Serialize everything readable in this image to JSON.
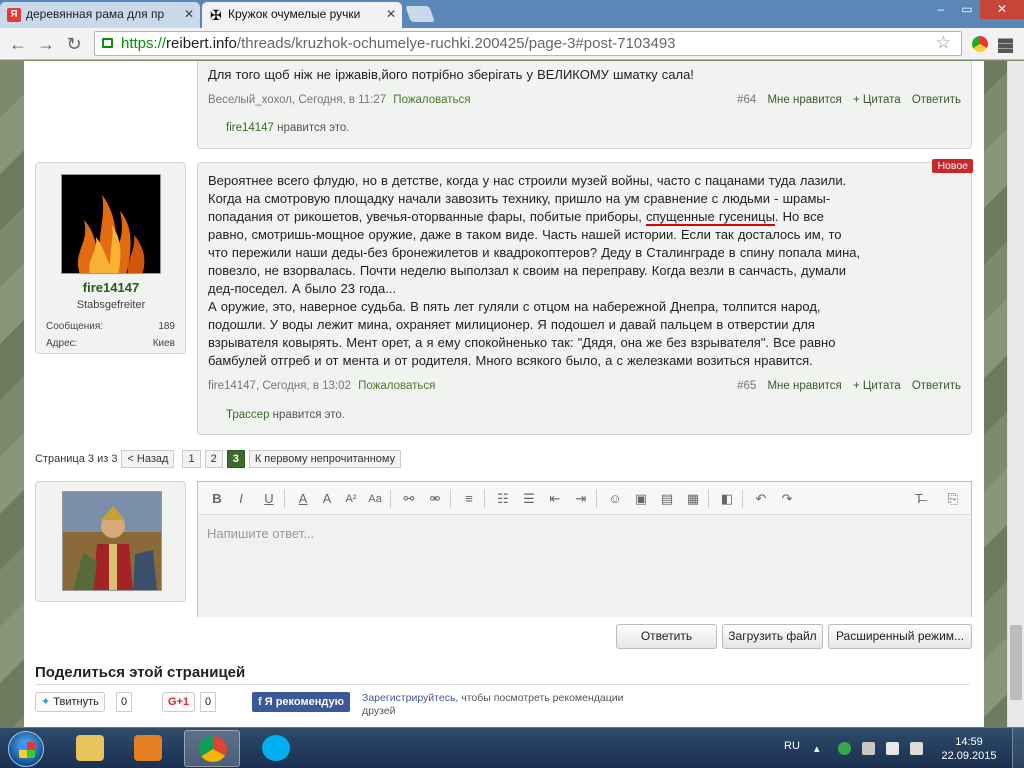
{
  "browser": {
    "tabs": [
      {
        "title": "деревянная рама для пр",
        "favicon": "Я"
      },
      {
        "title": "Кружок очумелые ручки",
        "favicon": "✠"
      }
    ],
    "url_secure": "https://",
    "url_domain": "reibert.info",
    "url_path": "/threads/kruzhok-ochumelye-ruchki.200425/page-3#post-7103493",
    "window_buttons": [
      "–",
      "▭",
      "✕"
    ]
  },
  "posts": [
    {
      "text": "Для того щоб ніж не іржавів,його потрібно зберігать у ВЕЛИКОМУ шматку сала!",
      "author": "Веселый_хохол",
      "time": "Сегодня, в 11:27",
      "report": "Пожаловаться",
      "number": "#64",
      "like": "Мне нравится",
      "quote": "+ Цитата",
      "reply": "Ответить",
      "liked_by": "fire14147",
      "liked_suffix": "нравится это."
    },
    {
      "badge": "Новое",
      "lines": [
        "Вероятнее всего флудю, но в детстве, когда у нас строили музей войны, часто с пацанами туда лазили.",
        "Когда на смотровую площадку начали завозить технику, пришло на ум сравнение с людьми - шрамы-",
        "попадания от рикошетов, увечья-оторванные фары, побитые приборы,",
        "спущенные гусеницы",
        ". Но все",
        "равно, смотришь-мощное оружие, даже в таком виде. Часть нашей истории. Если так досталось им, то",
        "что пережили наши деды-без бронежилетов и квадрокоптеров? Деду в Сталинграде в спину попала мина,",
        "повезло, не взорвалась. Почти неделю выползал к своим на переправу. Когда везли в санчасть, думали",
        "дед-поседел. А было 23 года...",
        "А оружие, это, наверное судьба. В пять лет гуляли с отцом на набережной Днепра, толпится народ,",
        "подошли. У воды лежит мина, охраняет милиционер. Я подошел и давай пальцем в отверстии для",
        "взрывателя ковырять. Мент орет, а я ему спокойненько так: \"Дядя, она же без взрывателя\". Все равно",
        "бамбулей отгреб и от мента и от родителя. Много всякого было, а с железками возиться нравится."
      ],
      "author": "fire14147",
      "time": "Сегодня, в 13:02",
      "report": "Пожаловаться",
      "number": "#65",
      "like": "Мне нравится",
      "quote": "+ Цитата",
      "reply": "Ответить",
      "liked_by": "Трассер",
      "liked_suffix": "нравится это."
    }
  ],
  "user": {
    "name": "fire14147",
    "title": "Stabsgefreiter",
    "messages_label": "Сообщения:",
    "messages_value": "189",
    "address_label": "Адрес:",
    "address_value": "Киев"
  },
  "pager": {
    "label": "Страница 3 из 3",
    "back": "< Назад",
    "pages": [
      "1",
      "2",
      "3"
    ],
    "first_unread": "К первому непрочитанному"
  },
  "editor": {
    "placeholder": "Напишите ответ...",
    "tools": [
      "B",
      "I",
      "U",
      "A",
      "A",
      "A²",
      "Aa",
      "link",
      "unlink",
      "align",
      "bullets",
      "numbers",
      "outdent",
      "indent",
      "smile",
      "image",
      "media",
      "code",
      "save",
      "undo",
      "redo",
      "clear",
      "source"
    ]
  },
  "actions": {
    "reply": "Ответить",
    "upload": "Загрузить файл",
    "advanced": "Расширенный режим..."
  },
  "share": {
    "title": "Поделиться этой страницей",
    "tweet": "Твитнуть",
    "tweet_count": "0",
    "gplus": "G+1",
    "gplus_count": "0",
    "fb": "Я рекомендую",
    "fb_link": "Зарегистрируйтесь",
    "fb_text": ", чтобы посмотреть рекомендации друзей"
  },
  "taskbar": {
    "lang": "RU",
    "time": "14:59",
    "date": "22.09.2015"
  }
}
